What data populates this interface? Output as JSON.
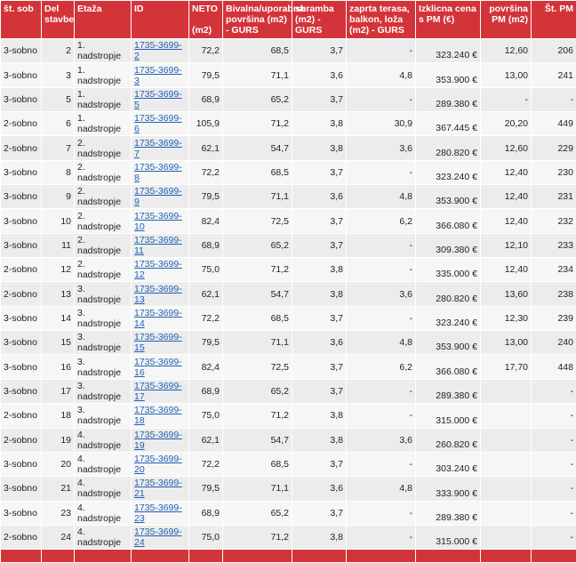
{
  "headers": {
    "rooms": "št. sob",
    "part": "Del stavbe",
    "floor": "Etaža",
    "id": "ID",
    "neto": "NETO",
    "neto_unit": "(m2)",
    "living": "Bivalna/uporabna površina (m2) - GURS",
    "storage": "shramba (m2) - GURS",
    "terrace": "zaprta terasa, balkon, loža (m2) - GURS",
    "price": "Izklicna cena s PM (€)",
    "pm_area": "površina PM (m2)",
    "pm_no": "Št. PM"
  },
  "rows": [
    {
      "rooms": "3-sobno",
      "part": "2",
      "floor": "1. nadstropje",
      "id": "1735-3699-2",
      "neto": "72,2",
      "living": "68,5",
      "storage": "3,7",
      "terrace": "-",
      "price": "323.240 €",
      "pm_area": "12,60",
      "pm_no": "206"
    },
    {
      "rooms": "3-sobno",
      "part": "3",
      "floor": "1. nadstropje",
      "id": "1735-3699-3",
      "neto": "79,5",
      "living": "71,1",
      "storage": "3,6",
      "terrace": "4,8",
      "price": "353.900 €",
      "pm_area": "13,00",
      "pm_no": "241"
    },
    {
      "rooms": "3-sobno",
      "part": "5",
      "floor": "1. nadstropje",
      "id": "1735-3699-5",
      "neto": "68,9",
      "living": "65,2",
      "storage": "3,7",
      "terrace": "-",
      "price": "289.380 €",
      "pm_area": "-",
      "pm_no": "-"
    },
    {
      "rooms": "2-sobno",
      "part": "6",
      "floor": "1. nadstropje",
      "id": "1735-3699-6",
      "neto": "105,9",
      "living": "71,2",
      "storage": "3,8",
      "terrace": "30,9",
      "price": "367.445 €",
      "pm_area": "20,20",
      "pm_no": "449"
    },
    {
      "rooms": "2-sobno",
      "part": "7",
      "floor": "2. nadstropje",
      "id": "1735-3699-7",
      "neto": "62,1",
      "living": "54,7",
      "storage": "3,8",
      "terrace": "3,6",
      "price": "280.820 €",
      "pm_area": "12,60",
      "pm_no": "229"
    },
    {
      "rooms": "3-sobno",
      "part": "8",
      "floor": "2. nadstropje",
      "id": "1735-3699-8",
      "neto": "72,2",
      "living": "68,5",
      "storage": "3,7",
      "terrace": "-",
      "price": "323.240 €",
      "pm_area": "12,40",
      "pm_no": "230"
    },
    {
      "rooms": "3-sobno",
      "part": "9",
      "floor": "2. nadstropje",
      "id": "1735-3699-9",
      "neto": "79,5",
      "living": "71,1",
      "storage": "3,6",
      "terrace": "4,8",
      "price": "353.900 €",
      "pm_area": "12,40",
      "pm_no": "231"
    },
    {
      "rooms": "3-sobno",
      "part": "10",
      "floor": "2. nadstropje",
      "id": "1735-3699-10",
      "neto": "82,4",
      "living": "72,5",
      "storage": "3,7",
      "terrace": "6,2",
      "price": "366.080 €",
      "pm_area": "12,40",
      "pm_no": "232"
    },
    {
      "rooms": "3-sobno",
      "part": "11",
      "floor": "2. nadstropje",
      "id": "1735-3699-11",
      "neto": "68,9",
      "living": "65,2",
      "storage": "3,7",
      "terrace": "-",
      "price": "309.380 €",
      "pm_area": "12,10",
      "pm_no": "233"
    },
    {
      "rooms": "2-sobno",
      "part": "12",
      "floor": "2. nadstropje",
      "id": "1735-3699-12",
      "neto": "75,0",
      "living": "71,2",
      "storage": "3,8",
      "terrace": "-",
      "price": "335.000 €",
      "pm_area": "12,40",
      "pm_no": "234"
    },
    {
      "rooms": "2-sobno",
      "part": "13",
      "floor": "3. nadstropje",
      "id": "1735-3699-13",
      "neto": "62,1",
      "living": "54,7",
      "storage": "3,8",
      "terrace": "3,6",
      "price": "280.820 €",
      "pm_area": "13,60",
      "pm_no": "238"
    },
    {
      "rooms": "3-sobno",
      "part": "14",
      "floor": "3. nadstropje",
      "id": "1735-3699-14",
      "neto": "72,2",
      "living": "68,5",
      "storage": "3,7",
      "terrace": "-",
      "price": "323.240 €",
      "pm_area": "12,30",
      "pm_no": "239"
    },
    {
      "rooms": "3-sobno",
      "part": "15",
      "floor": "3. nadstropje",
      "id": "1735-3699-15",
      "neto": "79,5",
      "living": "71,1",
      "storage": "3,6",
      "terrace": "4,8",
      "price": "353.900 €",
      "pm_area": "13,00",
      "pm_no": "240"
    },
    {
      "rooms": "3-sobno",
      "part": "16",
      "floor": "3. nadstropje",
      "id": "1735-3699-16",
      "neto": "82,4",
      "living": "72,5",
      "storage": "3,7",
      "terrace": "6,2",
      "price": "366.080 €",
      "pm_area": "17,70",
      "pm_no": "448"
    },
    {
      "rooms": "3-sobno",
      "part": "17",
      "floor": "3. nadstropje",
      "id": "1735-3699-17",
      "neto": "68,9",
      "living": "65,2",
      "storage": "3,7",
      "terrace": "-",
      "price": "289.380 €",
      "pm_area": "",
      "pm_no": "-"
    },
    {
      "rooms": "2-sobno",
      "part": "18",
      "floor": "3. nadstropje",
      "id": "1735-3699-18",
      "neto": "75,0",
      "living": "71,2",
      "storage": "3,8",
      "terrace": "-",
      "price": "315.000 €",
      "pm_area": "",
      "pm_no": "-"
    },
    {
      "rooms": "2-sobno",
      "part": "19",
      "floor": "4. nadstropje",
      "id": "1735-3699-19",
      "neto": "62,1",
      "living": "54,7",
      "storage": "3,8",
      "terrace": "3,6",
      "price": "260.820 €",
      "pm_area": "",
      "pm_no": "-"
    },
    {
      "rooms": "3-sobno",
      "part": "20",
      "floor": "4. nadstropje",
      "id": "1735-3699-20",
      "neto": "72,2",
      "living": "68,5",
      "storage": "3,7",
      "terrace": "-",
      "price": "303.240 €",
      "pm_area": "",
      "pm_no": "-"
    },
    {
      "rooms": "3-sobno",
      "part": "21",
      "floor": "4. nadstropje",
      "id": "1735-3699-21",
      "neto": "79,5",
      "living": "71,1",
      "storage": "3,6",
      "terrace": "4,8",
      "price": "333.900 €",
      "pm_area": "",
      "pm_no": "-"
    },
    {
      "rooms": "3-sobno",
      "part": "23",
      "floor": "4. nadstropje",
      "id": "1735-3699-23",
      "neto": "68,9",
      "living": "65,2",
      "storage": "3,7",
      "terrace": "-",
      "price": "289.380 €",
      "pm_area": "",
      "pm_no": "-"
    },
    {
      "rooms": "2-sobno",
      "part": "24",
      "floor": "4. nadstropje",
      "id": "1735-3699-24",
      "neto": "75,0",
      "living": "71,2",
      "storage": "3,8",
      "terrace": "-",
      "price": "315.000 €",
      "pm_area": "",
      "pm_no": "-"
    }
  ],
  "colors": {
    "header_bg": "#d3343a",
    "link": "#1f5fb5"
  }
}
